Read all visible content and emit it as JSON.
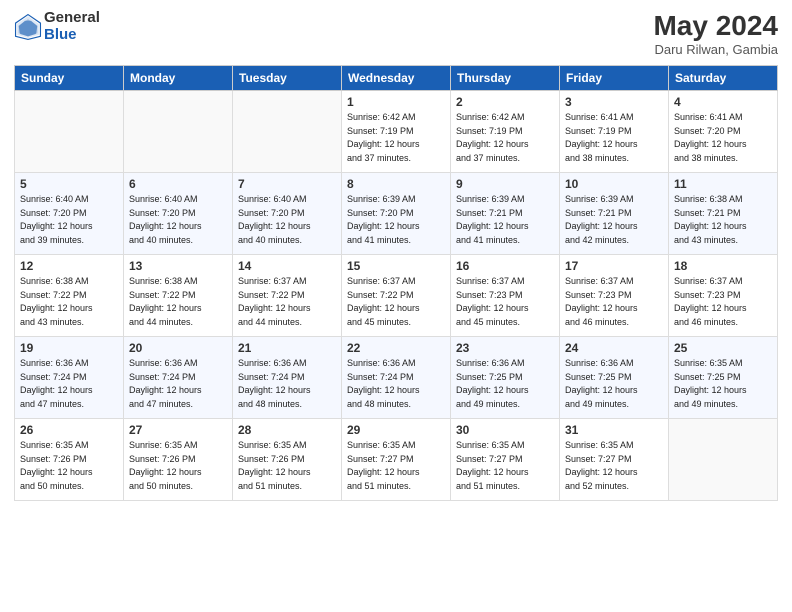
{
  "header": {
    "logo_general": "General",
    "logo_blue": "Blue",
    "month_year": "May 2024",
    "location": "Daru Rilwan, Gambia"
  },
  "days_of_week": [
    "Sunday",
    "Monday",
    "Tuesday",
    "Wednesday",
    "Thursday",
    "Friday",
    "Saturday"
  ],
  "weeks": [
    [
      {
        "day": "",
        "info": ""
      },
      {
        "day": "",
        "info": ""
      },
      {
        "day": "",
        "info": ""
      },
      {
        "day": "1",
        "info": "Sunrise: 6:42 AM\nSunset: 7:19 PM\nDaylight: 12 hours\nand 37 minutes."
      },
      {
        "day": "2",
        "info": "Sunrise: 6:42 AM\nSunset: 7:19 PM\nDaylight: 12 hours\nand 37 minutes."
      },
      {
        "day": "3",
        "info": "Sunrise: 6:41 AM\nSunset: 7:19 PM\nDaylight: 12 hours\nand 38 minutes."
      },
      {
        "day": "4",
        "info": "Sunrise: 6:41 AM\nSunset: 7:20 PM\nDaylight: 12 hours\nand 38 minutes."
      }
    ],
    [
      {
        "day": "5",
        "info": "Sunrise: 6:40 AM\nSunset: 7:20 PM\nDaylight: 12 hours\nand 39 minutes."
      },
      {
        "day": "6",
        "info": "Sunrise: 6:40 AM\nSunset: 7:20 PM\nDaylight: 12 hours\nand 40 minutes."
      },
      {
        "day": "7",
        "info": "Sunrise: 6:40 AM\nSunset: 7:20 PM\nDaylight: 12 hours\nand 40 minutes."
      },
      {
        "day": "8",
        "info": "Sunrise: 6:39 AM\nSunset: 7:20 PM\nDaylight: 12 hours\nand 41 minutes."
      },
      {
        "day": "9",
        "info": "Sunrise: 6:39 AM\nSunset: 7:21 PM\nDaylight: 12 hours\nand 41 minutes."
      },
      {
        "day": "10",
        "info": "Sunrise: 6:39 AM\nSunset: 7:21 PM\nDaylight: 12 hours\nand 42 minutes."
      },
      {
        "day": "11",
        "info": "Sunrise: 6:38 AM\nSunset: 7:21 PM\nDaylight: 12 hours\nand 43 minutes."
      }
    ],
    [
      {
        "day": "12",
        "info": "Sunrise: 6:38 AM\nSunset: 7:22 PM\nDaylight: 12 hours\nand 43 minutes."
      },
      {
        "day": "13",
        "info": "Sunrise: 6:38 AM\nSunset: 7:22 PM\nDaylight: 12 hours\nand 44 minutes."
      },
      {
        "day": "14",
        "info": "Sunrise: 6:37 AM\nSunset: 7:22 PM\nDaylight: 12 hours\nand 44 minutes."
      },
      {
        "day": "15",
        "info": "Sunrise: 6:37 AM\nSunset: 7:22 PM\nDaylight: 12 hours\nand 45 minutes."
      },
      {
        "day": "16",
        "info": "Sunrise: 6:37 AM\nSunset: 7:23 PM\nDaylight: 12 hours\nand 45 minutes."
      },
      {
        "day": "17",
        "info": "Sunrise: 6:37 AM\nSunset: 7:23 PM\nDaylight: 12 hours\nand 46 minutes."
      },
      {
        "day": "18",
        "info": "Sunrise: 6:37 AM\nSunset: 7:23 PM\nDaylight: 12 hours\nand 46 minutes."
      }
    ],
    [
      {
        "day": "19",
        "info": "Sunrise: 6:36 AM\nSunset: 7:24 PM\nDaylight: 12 hours\nand 47 minutes."
      },
      {
        "day": "20",
        "info": "Sunrise: 6:36 AM\nSunset: 7:24 PM\nDaylight: 12 hours\nand 47 minutes."
      },
      {
        "day": "21",
        "info": "Sunrise: 6:36 AM\nSunset: 7:24 PM\nDaylight: 12 hours\nand 48 minutes."
      },
      {
        "day": "22",
        "info": "Sunrise: 6:36 AM\nSunset: 7:24 PM\nDaylight: 12 hours\nand 48 minutes."
      },
      {
        "day": "23",
        "info": "Sunrise: 6:36 AM\nSunset: 7:25 PM\nDaylight: 12 hours\nand 49 minutes."
      },
      {
        "day": "24",
        "info": "Sunrise: 6:36 AM\nSunset: 7:25 PM\nDaylight: 12 hours\nand 49 minutes."
      },
      {
        "day": "25",
        "info": "Sunrise: 6:35 AM\nSunset: 7:25 PM\nDaylight: 12 hours\nand 49 minutes."
      }
    ],
    [
      {
        "day": "26",
        "info": "Sunrise: 6:35 AM\nSunset: 7:26 PM\nDaylight: 12 hours\nand 50 minutes."
      },
      {
        "day": "27",
        "info": "Sunrise: 6:35 AM\nSunset: 7:26 PM\nDaylight: 12 hours\nand 50 minutes."
      },
      {
        "day": "28",
        "info": "Sunrise: 6:35 AM\nSunset: 7:26 PM\nDaylight: 12 hours\nand 51 minutes."
      },
      {
        "day": "29",
        "info": "Sunrise: 6:35 AM\nSunset: 7:27 PM\nDaylight: 12 hours\nand 51 minutes."
      },
      {
        "day": "30",
        "info": "Sunrise: 6:35 AM\nSunset: 7:27 PM\nDaylight: 12 hours\nand 51 minutes."
      },
      {
        "day": "31",
        "info": "Sunrise: 6:35 AM\nSunset: 7:27 PM\nDaylight: 12 hours\nand 52 minutes."
      },
      {
        "day": "",
        "info": ""
      }
    ]
  ]
}
